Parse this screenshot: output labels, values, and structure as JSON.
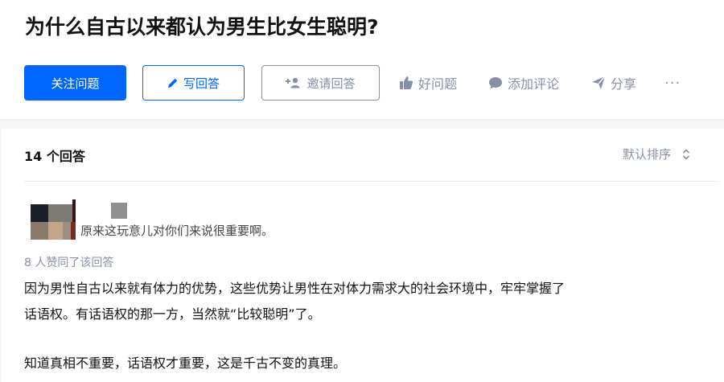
{
  "question": {
    "title": "为什么自古以来都认为男生比女生聪明?"
  },
  "buttons": {
    "follow": "关注问题",
    "write": "写回答",
    "invite": "邀请回答"
  },
  "actions": {
    "good_question": "好问题",
    "add_comment": "添加评论",
    "share": "分享",
    "more": "···"
  },
  "answers_header": {
    "count": "14 个回答",
    "sort": "默认排序"
  },
  "answer": {
    "author_bio": "原来这玩意儿对你们来说很重要啊。",
    "votes": "8 人赞同了该回答",
    "paragraphs": [
      "因为男性自古以来就有体力的优势，这些优势让男性在对体力需求大的社会环境中，牢牢掌握了",
      "话语权。有话语权的那一方，当然就“比较聪明”了。",
      "知道真相不重要，话语权才重要，这是千古不变的真理。"
    ]
  },
  "colors": {
    "brand": "#0066ff",
    "muted": "#8590a6",
    "text": "#121212"
  }
}
